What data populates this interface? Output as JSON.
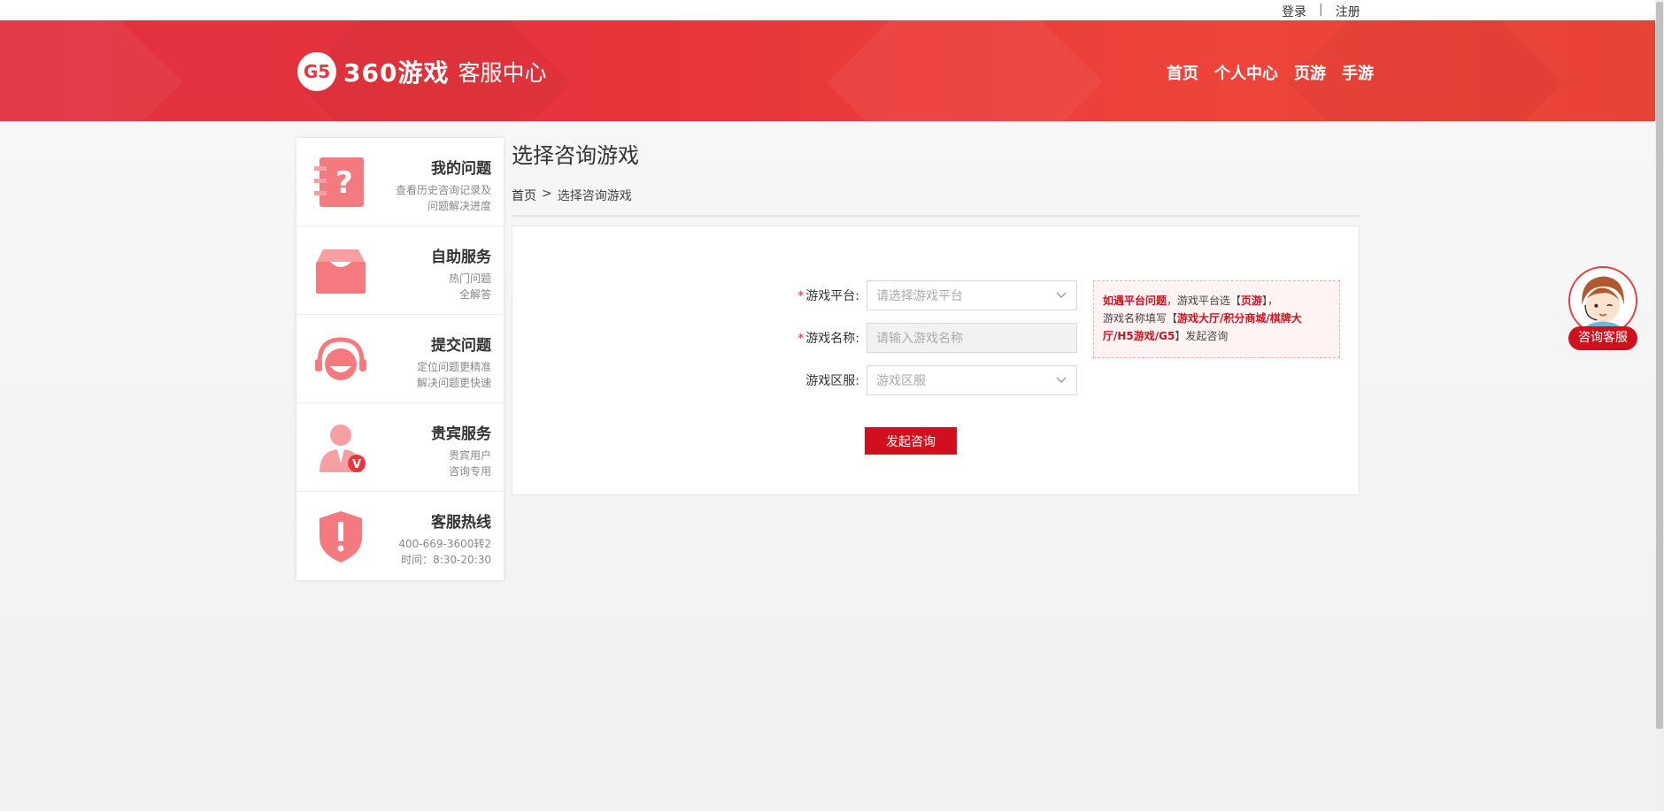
{
  "topbar": {
    "login": "登录",
    "separator": "|",
    "register": "注册"
  },
  "header": {
    "logo_mark": "G5",
    "logo_brand": "360游戏",
    "logo_sub": "客服中心",
    "nav": [
      {
        "label": "首页"
      },
      {
        "label": "个人中心"
      },
      {
        "label": "页游"
      },
      {
        "label": "手游"
      }
    ]
  },
  "sidebar": {
    "items": [
      {
        "title": "我的问题",
        "desc1": "查看历史咨询记录及",
        "desc2": "问题解决进度",
        "icon": "question-book-icon"
      },
      {
        "title": "自助服务",
        "desc1": "热门问题",
        "desc2": "全解答",
        "icon": "inbox-icon"
      },
      {
        "title": "提交问题",
        "desc1": "定位问题更精准",
        "desc2": "解决问题更快速",
        "icon": "headset-icon"
      },
      {
        "title": "贵宾服务",
        "desc1": "贵宾用户",
        "desc2": "咨询专用",
        "icon": "vip-user-icon"
      },
      {
        "title": "客服热线",
        "desc1": "400-669-3600转2",
        "desc2": "时间：8:30-20:30",
        "icon": "shield-alert-icon"
      }
    ]
  },
  "main": {
    "title": "选择咨询游戏",
    "breadcrumb": {
      "home": "首页",
      "sep": ">",
      "current": "选择咨询游戏"
    },
    "form": {
      "required_mark": "*",
      "platform": {
        "label": "游戏平台:",
        "placeholder": "请选择游戏平台"
      },
      "name": {
        "label": "游戏名称:",
        "placeholder": "请输入游戏名称"
      },
      "server": {
        "label": "游戏区服:",
        "placeholder": "游戏区服"
      },
      "submit": "发起咨询"
    },
    "tip": {
      "part1": "如遇平台问题",
      "part2": "，游戏平台选【",
      "part3": "页游",
      "part4": "】，",
      "part5": "游戏名称填写【",
      "part6": "游戏大厅/积分商城/棋牌大厅/H5游戏/G5",
      "part7": "】发起咨询"
    }
  },
  "consult": {
    "label": "咨询客服"
  },
  "colors": {
    "brand_red": "#d0111d",
    "header_red": "#e7373c"
  }
}
